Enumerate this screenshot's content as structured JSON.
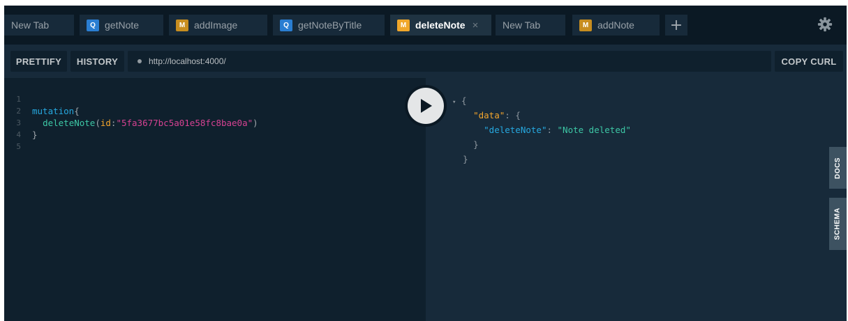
{
  "tabs": [
    {
      "label": "New Tab",
      "badge": ""
    },
    {
      "label": "getNote",
      "badge": "Q"
    },
    {
      "label": "addImage",
      "badge": "M"
    },
    {
      "label": "getNoteByTitle",
      "badge": "Q"
    },
    {
      "label": "deleteNote",
      "badge": "M",
      "active": true,
      "close": "×"
    },
    {
      "label": "New Tab",
      "badge": ""
    },
    {
      "label": "addNote",
      "badge": "M"
    }
  ],
  "new_tab_symbol": "+",
  "toolbar": {
    "prettify_label": "PRETTIFY",
    "history_label": "HISTORY",
    "endpoint_url": "http://localhost:4000/",
    "copy_curl_label": "COPY CURL"
  },
  "editor": {
    "line_numbers": [
      "1",
      "2",
      "3",
      "4",
      "5"
    ],
    "keyword": "mutation",
    "open_brace": "{",
    "field": "deleteNote",
    "open_paren": "(",
    "arg_name": "id",
    "colon": ":",
    "arg_value": "\"5fa3677bc5a01e58fc8bae0a\"",
    "close_paren": ")",
    "close_brace": "}"
  },
  "result": {
    "collapse_arrow": "▾",
    "open_brace": "{",
    "data_key": "\"data\"",
    "colon_brace": ": {",
    "field_key": "\"deleteNote\"",
    "colon": ": ",
    "field_value": "\"Note deleted\"",
    "inner_close": "}",
    "outer_close": "}"
  },
  "side_tabs": {
    "docs_label": "DOCS",
    "schema_label": "SCHEMA"
  },
  "colors": {
    "query_badge": "#2a7ed2",
    "mutation_badge": "#c78d1f",
    "keyword": "#26a9e0",
    "field": "#3dc7a5",
    "argument": "#f4a52c",
    "string": "#d64292"
  },
  "icons": {
    "settings": "gear-icon",
    "run": "play-icon"
  }
}
